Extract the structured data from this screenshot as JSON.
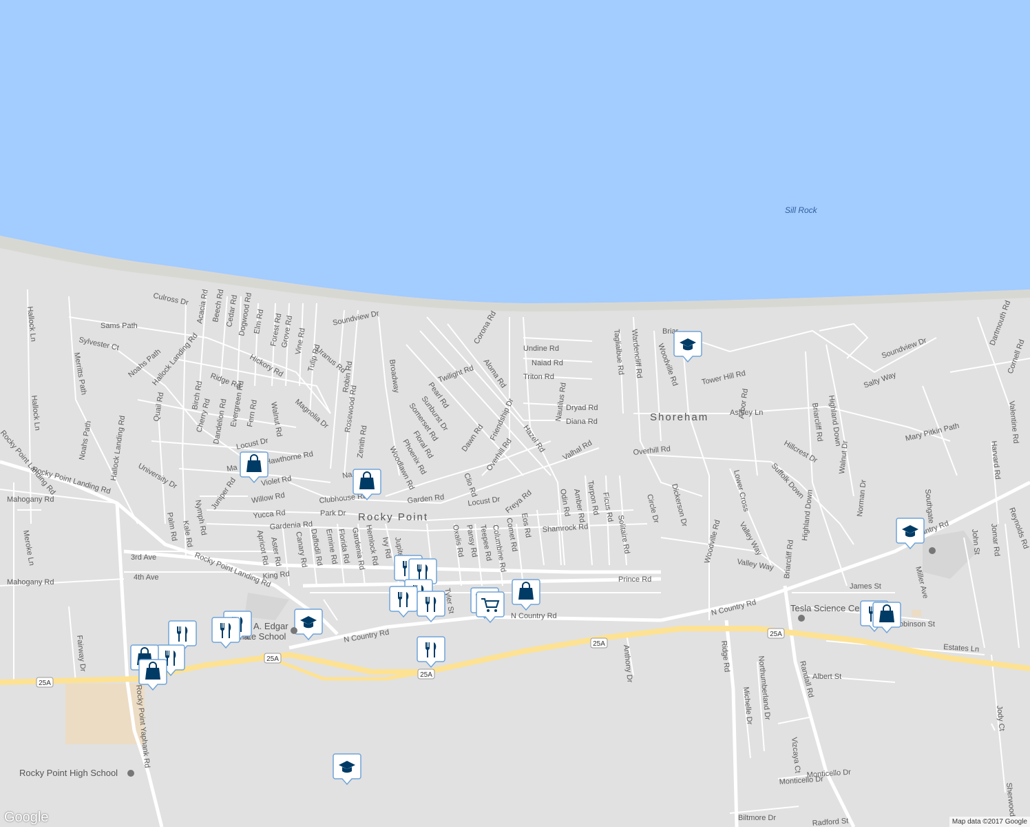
{
  "map": {
    "place_labels": [
      "Rocky Point",
      "Shoreham"
    ],
    "water_labels": [
      "Sill Rock"
    ],
    "poi_labels": [
      "Rocky Point High School",
      "Tesla Science Ce",
      "A. Edgar",
      "Int",
      "ate School"
    ],
    "road_labels": [
      "Culross Dr",
      "Soundview Dr",
      "Sams Path",
      "Sylvester Ct",
      "Merritts Path",
      "Noahs Path",
      "Hallock Ln",
      "Hallock Landing Rd",
      "Acacia Rd",
      "Beech Rd",
      "Cedar Rd",
      "Dogwood Rd",
      "Elm Rd",
      "Forest Rd",
      "Grove Rd",
      "Vine Rd",
      "Tulip Rd",
      "Uranus Rd",
      "Hickory Rd",
      "Ridge Rd",
      "Birch Rd",
      "Cherry Rd",
      "Dandelion Rd",
      "Evergreen Rd",
      "Fern Rd",
      "Walnut Rd",
      "Magnolia Dr",
      "Quail Rd",
      "University Dr",
      "Rocky Point Landing Rd",
      "Mahogany Rd",
      "Juniper Rd",
      "Locust Dr",
      "Violet Rd",
      "Willow Rd",
      "Yucca Rd",
      "Park Dr",
      "Clubhouse Rd",
      "Robin Rd",
      "Rosewood Rd",
      "Zenith Rd",
      "Broadway",
      "Woodlawn Rd",
      "Phoenix Rd",
      "Floral Rd",
      "Somerset Rd",
      "Sunburst Dr",
      "Pearl Rd",
      "Twilight Rd",
      "Corona Rd",
      "Aloma Rd",
      "Dawn Rd",
      "Friendship Dr",
      "Overhill Rd",
      "Hazel Rd",
      "Undine Rd",
      "Naiad Rd",
      "Triton Rd",
      "Dryad Rd",
      "Diana Rd",
      "Nautilus Rd",
      "Valhal Rd",
      "Garden Rd",
      "Clio Rd",
      "Freya Rd",
      "Odin Rd",
      "Amber Rd",
      "Tarpon Rd",
      "Ficus Rd",
      "Solitaire Rd",
      "Shamrock Rd",
      "Eos Rd",
      "Comet Rd",
      "Columbine Rd",
      "Teepee Rd",
      "Pansy Rd",
      "Oxalis Rd",
      "Jupiter",
      "Ivy Rd",
      "Hemlock Rd",
      "Gardenia Rd",
      "Florida Rd",
      "Ermine Rd",
      "Daffodil Rd",
      "Canary Rd",
      "Aster Rd",
      "Apricot Rd",
      "Kale Rd",
      "Nymph Rd",
      "Palm Rd",
      "Meroke Ln",
      "3rd Ave",
      "4th Ave",
      "King Rd",
      "Prince Rd",
      "Tyler St",
      "N Country Rd",
      "Fairway Dr",
      "Rocky Point Yaphank Rd",
      "Taglialbue Rd",
      "Wardencliff Rd",
      "Woodville Rd",
      "Tower Hill Rd",
      "Ashley Ln",
      "Overhill Rd",
      "Circle Dr",
      "Dickerson Dr",
      "Lower Cross",
      "Arbor Rd",
      "Suffolk Down",
      "Valley Way",
      "Briarcliff Rd",
      "Highland Down",
      "Hillcrest Dr",
      "Salty Way",
      "Soundview Dr",
      "Mary Pitkin Path",
      "Dartmouth Rd",
      "Cornell Rd",
      "Valentine Rd",
      "Harvard Rd",
      "Southgate",
      "Reynolds Rd",
      "Jomar Rd",
      "John St",
      "Miller Ave",
      "Walnut Dr",
      "Norman Dr",
      "James St",
      "Robinson St",
      "Estates Ln",
      "Albert St",
      "Ridge Rd",
      "Northumberland Dr",
      "Michelle Dr",
      "Randall Rd",
      "Vizcaya Ct",
      "Monticello Dr",
      "Biltmore Dr",
      "Radford St",
      "Anthony Dr",
      "Jody Ct",
      "Sherwood",
      "Briar",
      "Bi",
      "Na",
      "Ma",
      "Hawthorne Rd"
    ],
    "highway_shields": [
      "25A",
      "25A",
      "25A",
      "25A",
      "25A"
    ],
    "markers": [
      {
        "type": "school",
        "icon": "school-icon"
      },
      {
        "type": "shopping",
        "icon": "shopping-bag-icon"
      },
      {
        "type": "restaurant",
        "icon": "restaurant-icon"
      },
      {
        "type": "grocery",
        "icon": "shopping-cart-icon"
      }
    ]
  },
  "footer": {
    "logo": "Google",
    "attribution": "Map data ©2017 Google"
  },
  "colors": {
    "water": "#a3ccff",
    "land": "#e1e1e1",
    "beach": "#d8d8d3",
    "road": "#ffffff",
    "highway": "#fde293",
    "marker_fill": "#003b66",
    "marker_bg": "#ffffff",
    "marker_border": "#5b9bd5"
  }
}
